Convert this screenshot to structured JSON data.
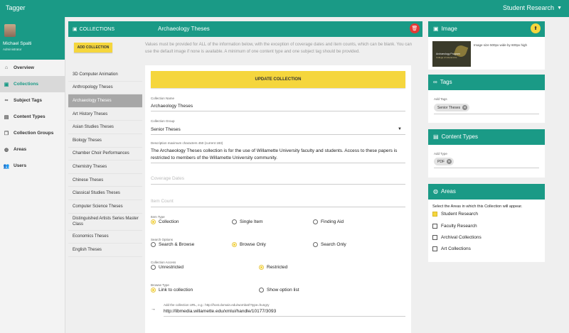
{
  "app": {
    "title": "Tagger",
    "site": "Student Research"
  },
  "user": {
    "name": "Michael Spalti",
    "role": "Administrator"
  },
  "nav": [
    {
      "label": "Overview",
      "icon": "home-icon"
    },
    {
      "label": "Collections",
      "icon": "collections-icon",
      "active": true
    },
    {
      "label": "Subject Tags",
      "icon": "link-icon"
    },
    {
      "label": "Content Types",
      "icon": "content-types-icon"
    },
    {
      "label": "Collection Groups",
      "icon": "collection-groups-icon"
    },
    {
      "label": "Areas",
      "icon": "globe-icon"
    },
    {
      "label": "Users",
      "icon": "users-icon"
    }
  ],
  "collections_panel": {
    "label": "COLLECTIONS",
    "title": "Archaeology Theses",
    "add_button": "ADD COLLECTION",
    "notice": "Values must be provided for ALL of the information below, with the exception of coverage dates and item counts, which can be blank. You can use the default image if none is available. A minimum of one content type and one subject tag should be provided.",
    "items": [
      "3D Computer Animation",
      "Anthropology Theses",
      "Archaeology Theses",
      "Art History Theses",
      "Asian Studies Theses",
      "Biology Theses",
      "Chamber Choir Performances",
      "Chemistry Theses",
      "Chinese Theses",
      "Classical Studies Theses",
      "Computer Science Theses",
      "Distinguished Artists Series Master Class",
      "Economics Theses",
      "English Theses"
    ],
    "active_index": 2
  },
  "form": {
    "update_button": "UPDATE COLLECTION",
    "collection_name": {
      "label": "Collection Name",
      "value": "Archaeology Theses"
    },
    "collection_group": {
      "label": "Collection Group",
      "value": "Senior Theses"
    },
    "description": {
      "label": "Description  maximum characters 450 (current 183)",
      "value": "The Archaeology Theses collection is for the use of Willamette University faculty and students. Access to these papers is restricted to members of the Willamette University community."
    },
    "coverage_dates": {
      "placeholder": "Coverage Dates"
    },
    "item_count": {
      "placeholder": "Item Count"
    },
    "item_type": {
      "label": "Item Type",
      "options": [
        "Collection",
        "Single Item",
        "Finding Aid"
      ],
      "selected": "Collection"
    },
    "search_options": {
      "label": "Search Options",
      "options": [
        "Search & Browse",
        "Browse Only",
        "Search Only"
      ],
      "selected": "Browse Only"
    },
    "collection_access": {
      "label": "Collection Access",
      "options": [
        "Unrestricted",
        "Restricted"
      ],
      "selected": "Restricted"
    },
    "browse_type": {
      "label": "Browse Type",
      "options": [
        "Link to collection",
        "Show option list"
      ],
      "selected": "Link to collection"
    },
    "url": {
      "label": "Add the collection URL, e.g.:  http://host.domain.edu/wombat/?type=hungry",
      "value": "http://libmedia.willamette.edu/xmlui/handle/10177/3093"
    }
  },
  "image_panel": {
    "title": "Image",
    "info": "Image size 500px wide by 600px high",
    "thumb_title": "Archaeology Program",
    "thumb_sub": "College of Liberal Arts"
  },
  "tags_panel": {
    "title": "Tags",
    "add_label": "Add Tags",
    "chips": [
      "Senior Theses"
    ]
  },
  "content_types_panel": {
    "title": "Content Types",
    "add_label": "Add Type",
    "chips": [
      "PDF"
    ]
  },
  "areas_panel": {
    "title": "Areas",
    "instruction": "Select the Areas in which this Collection will appear.",
    "options": [
      {
        "label": "Student Research",
        "checked": true
      },
      {
        "label": "Faculty Research",
        "checked": false
      },
      {
        "label": "Archival Collections",
        "checked": false
      },
      {
        "label": "Art Collections",
        "checked": false
      }
    ]
  },
  "colors": {
    "teal": "#1a9a86",
    "accent_yellow": "#f5d63d",
    "delete_red": "#e53935"
  }
}
